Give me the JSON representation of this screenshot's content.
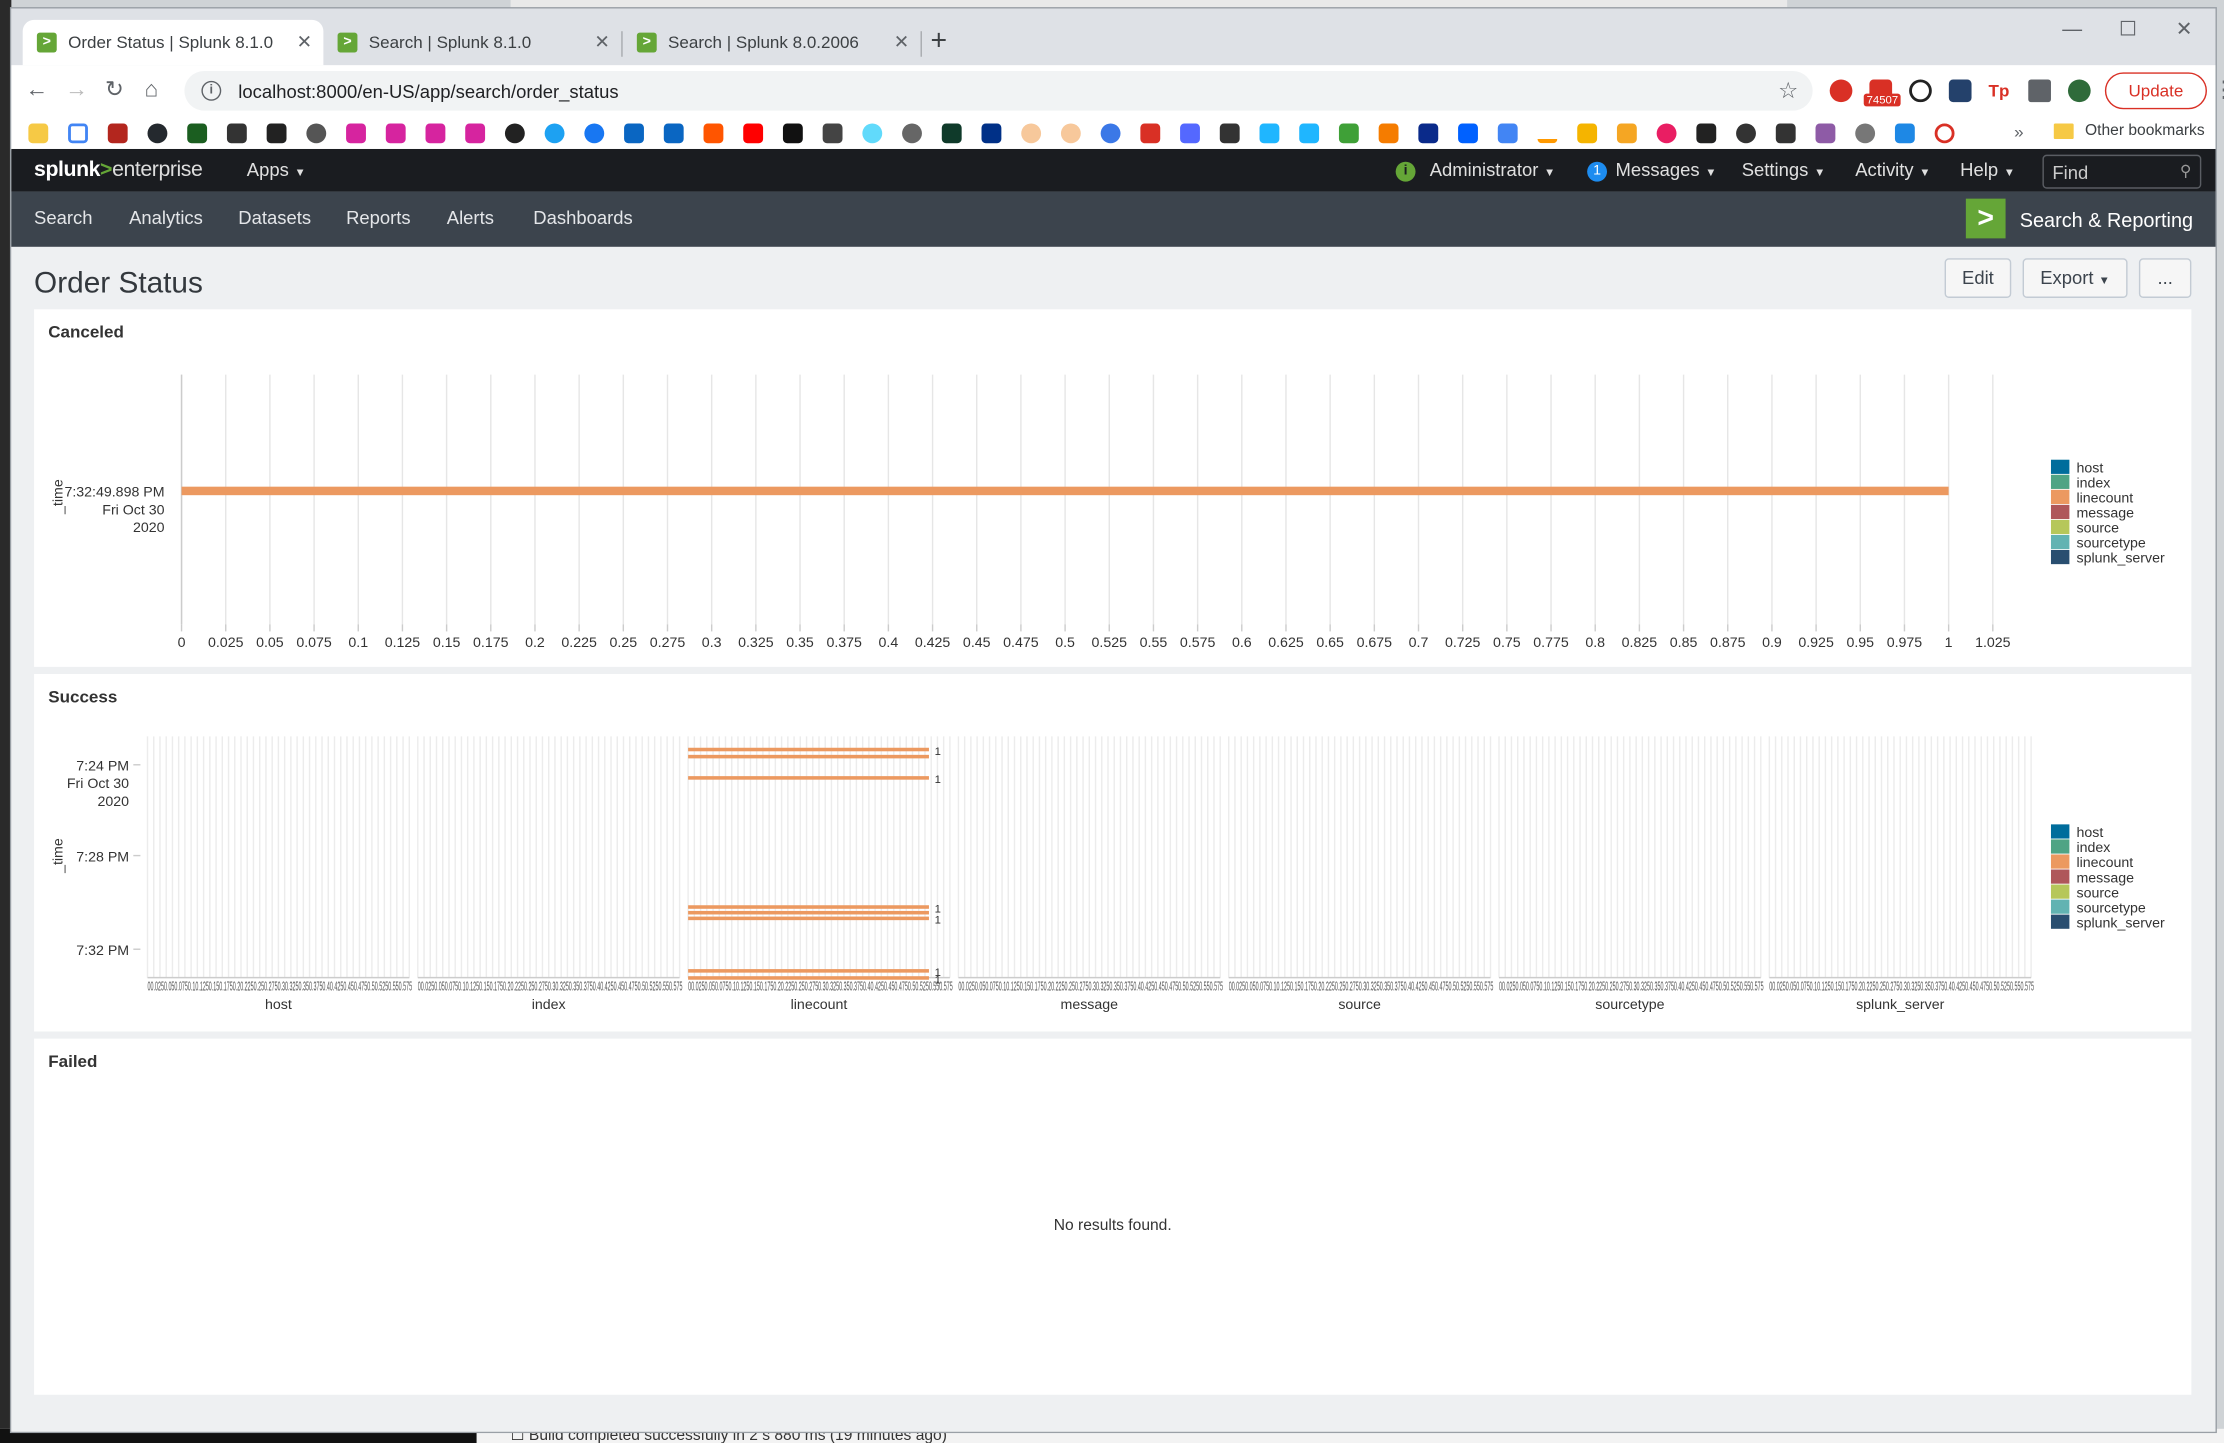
{
  "browser": {
    "tabs": [
      {
        "label": "Order Status | Splunk 8.1.0",
        "active": true
      },
      {
        "label": "Search | Splunk 8.1.0",
        "active": false
      },
      {
        "label": "Search | Splunk 8.0.2006",
        "active": false
      }
    ],
    "url": "localhost:8000/en-US/app/search/order_status",
    "update_label": "Update",
    "ext_badge": "74507",
    "other_bookmarks": "Other bookmarks"
  },
  "splunk": {
    "logo_a": "splunk",
    "logo_b": ">",
    "logo_c": "enterprise",
    "apps": "Apps",
    "user": "Administrator",
    "messages_count": "1",
    "messages": "Messages",
    "settings": "Settings",
    "activity": "Activity",
    "help": "Help",
    "find_placeholder": "Find",
    "nav": [
      "Search",
      "Analytics",
      "Datasets",
      "Reports",
      "Alerts",
      "Dashboards"
    ],
    "app_name": "Search & Reporting"
  },
  "dashboard": {
    "title": "Order Status",
    "edit": "Edit",
    "export": "Export",
    "more": "...",
    "panels": [
      {
        "title": "Canceled"
      },
      {
        "title": "Success"
      },
      {
        "title": "Failed",
        "message": "No results found."
      }
    ]
  },
  "chart_data": [
    {
      "type": "bar",
      "title": "Canceled",
      "ylabel": "_time",
      "categories": [
        "7:32:49.898 PM Fri Oct 30 2020"
      ],
      "series": [
        {
          "name": "linecount",
          "values": [
            1
          ]
        }
      ],
      "xlim": [
        0,
        1.025
      ],
      "xticks": [
        "0",
        "0.025",
        "0.05",
        "0.075",
        "0.1",
        "0.125",
        "0.15",
        "0.175",
        "0.2",
        "0.225",
        "0.25",
        "0.275",
        "0.3",
        "0.325",
        "0.35",
        "0.375",
        "0.4",
        "0.425",
        "0.45",
        "0.475",
        "0.5",
        "0.525",
        "0.55",
        "0.575",
        "0.6",
        "0.625",
        "0.65",
        "0.675",
        "0.7",
        "0.725",
        "0.75",
        "0.775",
        "0.8",
        "0.825",
        "0.85",
        "0.875",
        "0.9",
        "0.925",
        "0.95",
        "0.975",
        "1",
        "1.025"
      ],
      "legend": [
        "host",
        "index",
        "linecount",
        "message",
        "source",
        "sourcetype",
        "splunk_server"
      ],
      "legend_colors": [
        "#006d9c",
        "#4fa484",
        "#ec9960",
        "#af575a",
        "#b6c75a",
        "#62b3b2",
        "#294e70"
      ],
      "legend_position": "right"
    },
    {
      "type": "bar",
      "title": "Success",
      "ylabel": "_time",
      "yticks": [
        "7:24 PM Fri Oct 30 2020",
        "7:28 PM",
        "7:32 PM"
      ],
      "facets": [
        "host",
        "index",
        "linecount",
        "message",
        "source",
        "sourcetype",
        "splunk_server"
      ],
      "series": [
        {
          "name": "linecount",
          "values": [
            1,
            1,
            1,
            1,
            1,
            1,
            1,
            1
          ]
        }
      ],
      "data_label": "1",
      "legend": [
        "host",
        "index",
        "linecount",
        "message",
        "source",
        "sourcetype",
        "splunk_server"
      ],
      "legend_colors": [
        "#006d9c",
        "#4fa484",
        "#ec9960",
        "#af575a",
        "#b6c75a",
        "#62b3b2",
        "#294e70"
      ],
      "legend_position": "right"
    }
  ]
}
